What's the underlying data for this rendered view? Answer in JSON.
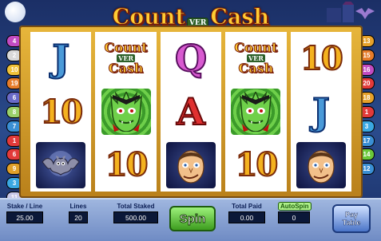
{
  "title": {
    "word_left": "Count",
    "word_ver": "VER",
    "word_right": "Cash"
  },
  "paylines_left": [
    {
      "n": "4",
      "color": "#c24bc2"
    },
    {
      "n": "2",
      "color": "#d9d9d9"
    },
    {
      "n": "10",
      "color": "#f0c23a"
    },
    {
      "n": "19",
      "color": "#e67c2a"
    },
    {
      "n": "6",
      "color": "#6a6ac8"
    },
    {
      "n": "8",
      "color": "#9ad06a"
    },
    {
      "n": "7",
      "color": "#3a8fd4"
    },
    {
      "n": "1",
      "color": "#e23a3a"
    },
    {
      "n": "6",
      "color": "#e23a3a"
    },
    {
      "n": "9",
      "color": "#e0a02a"
    },
    {
      "n": "3",
      "color": "#3aa8e2"
    },
    {
      "n": "11",
      "color": "#c8c8e8"
    },
    {
      "n": "5",
      "color": "#c04ac0"
    }
  ],
  "paylines_right": [
    {
      "n": "13",
      "color": "#e6a12a"
    },
    {
      "n": "15",
      "color": "#e67c2a"
    },
    {
      "n": "16",
      "color": "#c24bc2"
    },
    {
      "n": "20",
      "color": "#e23a3a"
    },
    {
      "n": "18",
      "color": "#e6a12a"
    },
    {
      "n": "1",
      "color": "#e23a3a"
    },
    {
      "n": "3",
      "color": "#3aa8e2"
    },
    {
      "n": "17",
      "color": "#3a8fd4"
    },
    {
      "n": "14",
      "color": "#6ac83a"
    },
    {
      "n": "12",
      "color": "#3a8fd4"
    }
  ],
  "reels": [
    [
      {
        "type": "J",
        "text": "J"
      },
      {
        "type": "10",
        "text": "10"
      },
      {
        "type": "bat",
        "text": ""
      }
    ],
    [
      {
        "type": "logo",
        "text": ""
      },
      {
        "type": "dracula",
        "text": ""
      },
      {
        "type": "10",
        "text": "10"
      }
    ],
    [
      {
        "type": "Q",
        "text": "Q"
      },
      {
        "type": "A",
        "text": "A"
      },
      {
        "type": "man",
        "text": ""
      }
    ],
    [
      {
        "type": "logo",
        "text": ""
      },
      {
        "type": "dracula",
        "text": ""
      },
      {
        "type": "10",
        "text": "10"
      }
    ],
    [
      {
        "type": "10",
        "text": "10"
      },
      {
        "type": "J",
        "text": "J"
      },
      {
        "type": "man",
        "text": ""
      }
    ]
  ],
  "controls": {
    "stake_label": "Stake / Line",
    "stake_value": "25.00",
    "lines_label": "Lines",
    "lines_value": "20",
    "total_staked_label": "Total Staked",
    "total_staked_value": "500.00",
    "spin_label": "Spin",
    "total_paid_label": "Total Paid",
    "total_paid_value": "0.00",
    "autospin_label": "AutoSpin",
    "autospin_value": "0",
    "paytable_line1": "Pay",
    "paytable_line2": "Table"
  }
}
